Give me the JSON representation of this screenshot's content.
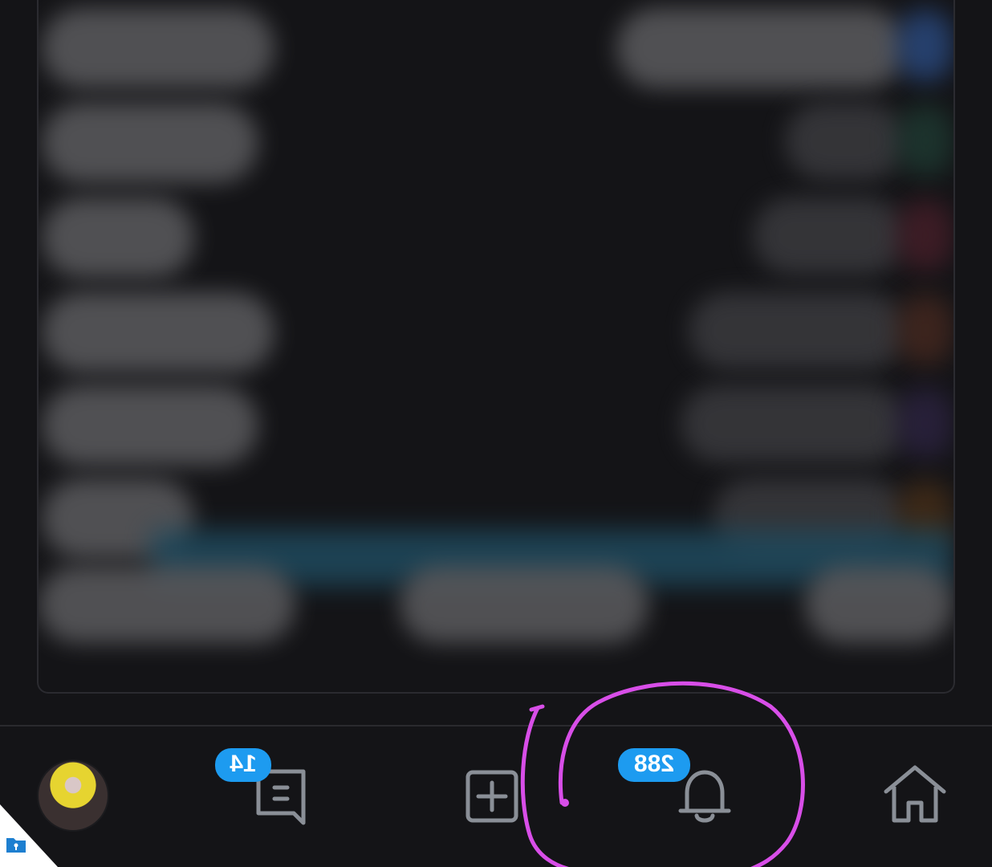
{
  "tabbar": {
    "messages_badge": "14",
    "notifications_badge": "288"
  },
  "colors": {
    "background": "#141417",
    "badge": "#1d9bf0",
    "icon": "#8a8f97",
    "annotation": "#d84ee8"
  },
  "icons": [
    "profile-avatar",
    "messages-icon",
    "compose-icon",
    "bell-icon",
    "home-icon"
  ]
}
